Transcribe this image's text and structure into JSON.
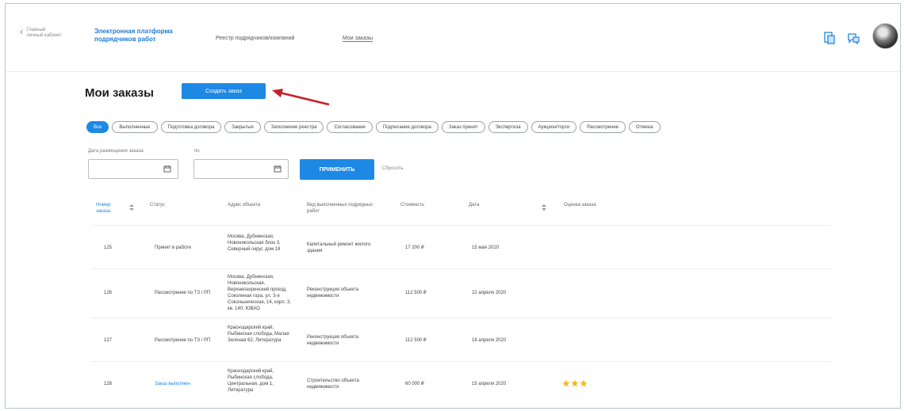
{
  "header": {
    "back_line1": "Главный",
    "back_line2": "личный кабинет",
    "brand_line1": "Электронная платформа",
    "brand_line2": "подрядчиков работ",
    "nav": [
      "Реестр подрядчиков/компаний",
      "Мои заказы"
    ]
  },
  "page": {
    "title": "Мои заказы",
    "create_button": "Создать заказ"
  },
  "chips": [
    "Все",
    "Выполненные",
    "Подготовка договора",
    "Закрытые",
    "Заполнение реестра",
    "Согласование",
    "Подписание договора",
    "Заказ принят",
    "Экспертиза",
    "Аукцион/торги",
    "Рассмотрение",
    "Отмена"
  ],
  "filters": {
    "date_from_label": "Дата размещения заказа",
    "date_to_label": "по",
    "date_from_value": "",
    "date_to_value": "",
    "apply": "ПРИМЕНИТЬ",
    "reset": "Сбросить"
  },
  "table": {
    "headers": [
      "Номер заказа",
      "Статус",
      "Адрес объекта",
      "Вид выполненных подрядных работ",
      "Стоимость",
      "Дата",
      "Оценка заказа"
    ],
    "rows": [
      {
        "id": "125",
        "status": "Принят в работе",
        "address": "Москва, Дубнинская, Новоникольская блок 3, Северный округ, дом 18",
        "work": "Капитальный ремонт жилого здания",
        "cost": "17 200 ₽",
        "date": "15 мая 2020",
        "rating": 0
      },
      {
        "id": "126",
        "status": "Рассмотрение по ТЗ / РП",
        "address": "Москва, Дубнинская, Новоникольская, Верхнепахринский проезд, Соколиная гора, ул. 3-я Сокольническая, 14, корп. 3, кв. 140, ЮВАО",
        "work": "Реконструкция объекта недвижимости",
        "cost": "112 500 ₽",
        "date": "22 апреля 2020",
        "rating": 0
      },
      {
        "id": "127",
        "status": "Рассмотрение по ТЗ / РП",
        "address": "Краснодарский край, Рыбинская слобода, Малая Зеленая 62, Литература",
        "work": "Реконструкция объекта недвижимости",
        "cost": "112 500 ₽",
        "date": "18 апреля 2020",
        "rating": 0
      },
      {
        "id": "128",
        "status": "Заказ выполнен",
        "address": "Краснодарский край, Рыбинская слобода, Центральная, дом 1, Литература",
        "work": "Строительство объекта недвижимости",
        "cost": "60 000 ₽",
        "date": "15 апреля 2020",
        "rating": 3
      }
    ]
  },
  "colors": {
    "accent": "#1e88e5",
    "arrow": "#c8202a",
    "star": "#f5b820"
  },
  "icons": [
    "chevron-left-icon",
    "document-icon",
    "chat-icon",
    "calendar-icon",
    "sort-icon",
    "star-icon"
  ]
}
